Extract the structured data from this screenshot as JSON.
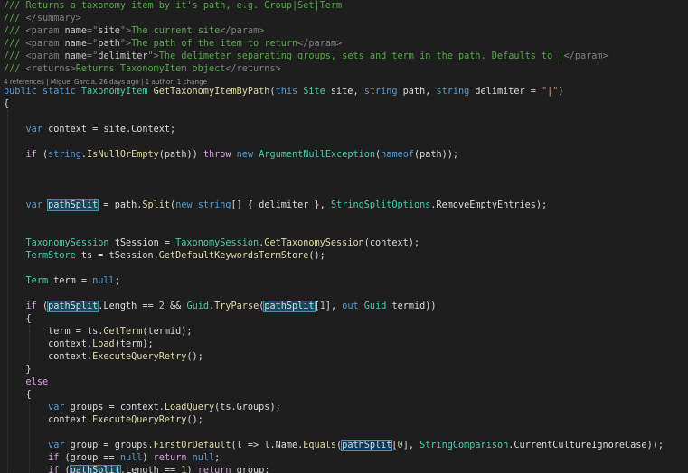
{
  "code_lens": "4 references | Miguel Garcia, 26 days ago | 1 author, 1 change",
  "colors": {
    "background": "#1e1e1e",
    "comment": "#57a64a",
    "keyword": "#569cd6",
    "control_keyword": "#d8a0df",
    "type": "#4ec9b0",
    "method": "#dcdcaa",
    "string": "#d69d85",
    "reference_highlight": "#124a5e"
  },
  "lines": [
    {
      "tokens": [
        [
          "/// ",
          "comment"
        ],
        [
          "Returns a taxonomy item by it's path, e.g. Group|Set|Term",
          "comment"
        ]
      ]
    },
    {
      "tokens": [
        [
          "/// ",
          "comment"
        ],
        [
          "</summary>",
          "xml"
        ]
      ]
    },
    {
      "tokens": [
        [
          "/// ",
          "comment"
        ],
        [
          "<param ",
          "xml"
        ],
        [
          "name",
          "xmlattr"
        ],
        [
          "=\"",
          "xml"
        ],
        [
          "site",
          "xmlstr"
        ],
        [
          "\">",
          "xml"
        ],
        [
          "The current site",
          "comment"
        ],
        [
          "</param>",
          "xml"
        ]
      ]
    },
    {
      "tokens": [
        [
          "/// ",
          "comment"
        ],
        [
          "<param ",
          "xml"
        ],
        [
          "name",
          "xmlattr"
        ],
        [
          "=\"",
          "xml"
        ],
        [
          "path",
          "xmlstr"
        ],
        [
          "\">",
          "xml"
        ],
        [
          "The path of the item to return",
          "comment"
        ],
        [
          "</param>",
          "xml"
        ]
      ]
    },
    {
      "tokens": [
        [
          "/// ",
          "comment"
        ],
        [
          "<param ",
          "xml"
        ],
        [
          "name",
          "xmlattr"
        ],
        [
          "=\"",
          "xml"
        ],
        [
          "delimiter",
          "xmlstr"
        ],
        [
          "\">",
          "xml"
        ],
        [
          "The delimeter separating groups, sets and term in the path. Defaults to |",
          "comment"
        ],
        [
          "</param>",
          "xml"
        ]
      ]
    },
    {
      "tokens": [
        [
          "/// ",
          "comment"
        ],
        [
          "<returns>",
          "xml"
        ],
        [
          "Returns TaxonomyItem object",
          "comment"
        ],
        [
          "</returns>",
          "xml"
        ]
      ]
    },
    {
      "tokens": [
        [
          "public ",
          "kw"
        ],
        [
          "static ",
          "kw"
        ],
        [
          "TaxonomyItem ",
          "type"
        ],
        [
          "GetTaxonomyItemByPath",
          "method"
        ],
        [
          "(",
          "plain"
        ],
        [
          "this ",
          "kw"
        ],
        [
          "Site ",
          "type"
        ],
        [
          "site, ",
          "plain"
        ],
        [
          "string ",
          "kw"
        ],
        [
          "path, ",
          "plain"
        ],
        [
          "string ",
          "kw"
        ],
        [
          "delimiter = ",
          "plain"
        ],
        [
          "\"|\"",
          "str"
        ],
        [
          ")",
          "plain"
        ]
      ]
    },
    {
      "tokens": [
        [
          "{",
          "plain"
        ]
      ]
    },
    {
      "tokens": []
    },
    {
      "tokens": [
        [
          "    ",
          "plain"
        ],
        [
          "var ",
          "kw"
        ],
        [
          "context = site.Context;",
          "plain"
        ]
      ]
    },
    {
      "tokens": []
    },
    {
      "tokens": [
        [
          "    ",
          "plain"
        ],
        [
          "if ",
          "ctrl"
        ],
        [
          "(",
          "plain"
        ],
        [
          "string",
          "kw"
        ],
        [
          ".",
          "plain"
        ],
        [
          "IsNullOrEmpty",
          "method"
        ],
        [
          "(path)) ",
          "plain"
        ],
        [
          "throw ",
          "ctrl"
        ],
        [
          "new ",
          "kw"
        ],
        [
          "ArgumentNullException",
          "type"
        ],
        [
          "(",
          "plain"
        ],
        [
          "nameof",
          "kw"
        ],
        [
          "(path));",
          "plain"
        ]
      ]
    },
    {
      "tokens": []
    },
    {
      "tokens": []
    },
    {
      "tokens": []
    },
    {
      "tokens": [
        [
          "    ",
          "plain"
        ],
        [
          "var ",
          "kw"
        ],
        [
          "pathSplit",
          "ref"
        ],
        [
          " = path.",
          "plain"
        ],
        [
          "Split",
          "method"
        ],
        [
          "(",
          "plain"
        ],
        [
          "new ",
          "kw"
        ],
        [
          "string",
          "kw"
        ],
        [
          "[] { delimiter }, ",
          "plain"
        ],
        [
          "StringSplitOptions",
          "type"
        ],
        [
          ".RemoveEmptyEntries);",
          "plain"
        ]
      ]
    },
    {
      "tokens": []
    },
    {
      "tokens": []
    },
    {
      "tokens": [
        [
          "    ",
          "plain"
        ],
        [
          "TaxonomySession ",
          "type"
        ],
        [
          "tSession = ",
          "plain"
        ],
        [
          "TaxonomySession",
          "type"
        ],
        [
          ".",
          "plain"
        ],
        [
          "GetTaxonomySession",
          "method"
        ],
        [
          "(context);",
          "plain"
        ]
      ]
    },
    {
      "tokens": [
        [
          "    ",
          "plain"
        ],
        [
          "TermStore ",
          "type"
        ],
        [
          "ts = tSession.",
          "plain"
        ],
        [
          "GetDefaultKeywordsTermStore",
          "method"
        ],
        [
          "();",
          "plain"
        ]
      ]
    },
    {
      "tokens": []
    },
    {
      "tokens": [
        [
          "    ",
          "plain"
        ],
        [
          "Term ",
          "type"
        ],
        [
          "term = ",
          "plain"
        ],
        [
          "null",
          "kw"
        ],
        [
          ";",
          "plain"
        ]
      ]
    },
    {
      "tokens": []
    },
    {
      "tokens": [
        [
          "    ",
          "plain"
        ],
        [
          "if ",
          "ctrl"
        ],
        [
          "(",
          "plain"
        ],
        [
          "pathSplit",
          "ref"
        ],
        [
          ".Length == ",
          "plain"
        ],
        [
          "2 ",
          "num"
        ],
        [
          "&& ",
          "plain"
        ],
        [
          "Guid",
          "type"
        ],
        [
          ".",
          "plain"
        ],
        [
          "TryParse",
          "method"
        ],
        [
          "(",
          "plain"
        ],
        [
          "pathSplit",
          "ref"
        ],
        [
          "[",
          "plain"
        ],
        [
          "1",
          "num"
        ],
        [
          "], ",
          "plain"
        ],
        [
          "out ",
          "kw"
        ],
        [
          "Guid ",
          "type"
        ],
        [
          "termid))",
          "plain"
        ]
      ]
    },
    {
      "tokens": [
        [
          "    {",
          "plain"
        ]
      ]
    },
    {
      "tokens": [
        [
          "        term = ts.",
          "plain"
        ],
        [
          "GetTerm",
          "method"
        ],
        [
          "(termid);",
          "plain"
        ]
      ]
    },
    {
      "tokens": [
        [
          "        context.",
          "plain"
        ],
        [
          "Load",
          "method"
        ],
        [
          "(term);",
          "plain"
        ]
      ]
    },
    {
      "tokens": [
        [
          "        context.",
          "plain"
        ],
        [
          "ExecuteQueryRetry",
          "method"
        ],
        [
          "();",
          "plain"
        ]
      ]
    },
    {
      "tokens": [
        [
          "    }",
          "plain"
        ]
      ]
    },
    {
      "tokens": [
        [
          "    ",
          "plain"
        ],
        [
          "else",
          "ctrl"
        ]
      ]
    },
    {
      "tokens": [
        [
          "    {",
          "plain"
        ]
      ]
    },
    {
      "tokens": [
        [
          "        ",
          "plain"
        ],
        [
          "var ",
          "kw"
        ],
        [
          "groups = context.",
          "plain"
        ],
        [
          "LoadQuery",
          "method"
        ],
        [
          "(ts.Groups);",
          "plain"
        ]
      ]
    },
    {
      "tokens": [
        [
          "        context.",
          "plain"
        ],
        [
          "ExecuteQueryRetry",
          "method"
        ],
        [
          "();",
          "plain"
        ]
      ]
    },
    {
      "tokens": []
    },
    {
      "tokens": [
        [
          "        ",
          "plain"
        ],
        [
          "var ",
          "kw"
        ],
        [
          "group = groups.",
          "plain"
        ],
        [
          "FirstOrDefault",
          "method"
        ],
        [
          "(l => l.Name.",
          "plain"
        ],
        [
          "Equals",
          "method"
        ],
        [
          "(",
          "plain"
        ],
        [
          "pathSplit",
          "sel"
        ],
        [
          "[",
          "plain"
        ],
        [
          "0",
          "num"
        ],
        [
          "], ",
          "plain"
        ],
        [
          "StringComparison",
          "type"
        ],
        [
          ".CurrentCultureIgnoreCase));",
          "plain"
        ]
      ]
    },
    {
      "tokens": [
        [
          "        ",
          "plain"
        ],
        [
          "if ",
          "ctrl"
        ],
        [
          "(group == ",
          "plain"
        ],
        [
          "null",
          "kw"
        ],
        [
          ") ",
          "plain"
        ],
        [
          "return ",
          "ctrl"
        ],
        [
          "null",
          "kw"
        ],
        [
          ";",
          "plain"
        ]
      ]
    },
    {
      "tokens": [
        [
          "        ",
          "plain"
        ],
        [
          "if ",
          "ctrl"
        ],
        [
          "(",
          "plain"
        ],
        [
          "pathSplit",
          "ref"
        ],
        [
          ".Length == ",
          "plain"
        ],
        [
          "1",
          "num"
        ],
        [
          ") ",
          "plain"
        ],
        [
          "return ",
          "ctrl"
        ],
        [
          "group;",
          "plain"
        ]
      ]
    }
  ]
}
